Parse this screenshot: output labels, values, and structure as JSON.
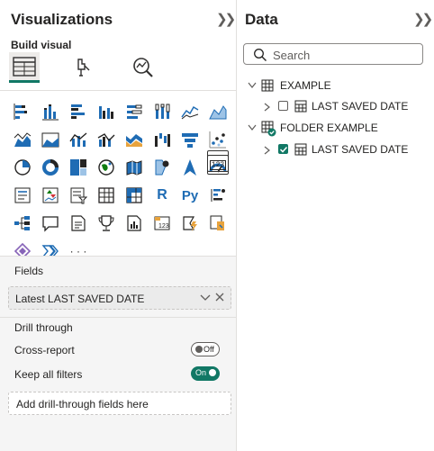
{
  "viz_pane": {
    "title": "Visualizations",
    "build_label": "Build visual",
    "more_visuals": "· · ·",
    "fields_label": "Fields",
    "field_value": "Latest LAST SAVED DATE",
    "drill_through_label": "Drill through",
    "cross_report_label": "Cross-report",
    "cross_report_state": "Off",
    "keep_filters_label": "Keep all filters",
    "keep_filters_state": "On",
    "drop_placeholder": "Add drill-through fields here",
    "r_glyph": "R",
    "py_glyph": "Py",
    "card_glyph": "123"
  },
  "data_pane": {
    "title": "Data",
    "search_placeholder": "Search",
    "tables": [
      {
        "name": "EXAMPLE",
        "field": "LAST SAVED DATE",
        "checked": false
      },
      {
        "name": "FOLDER EXAMPLE",
        "field": "LAST SAVED DATE",
        "checked": true
      }
    ]
  },
  "colors": {
    "accent": "#117865",
    "blue": "#1f6cb4",
    "dark": "#252423"
  }
}
